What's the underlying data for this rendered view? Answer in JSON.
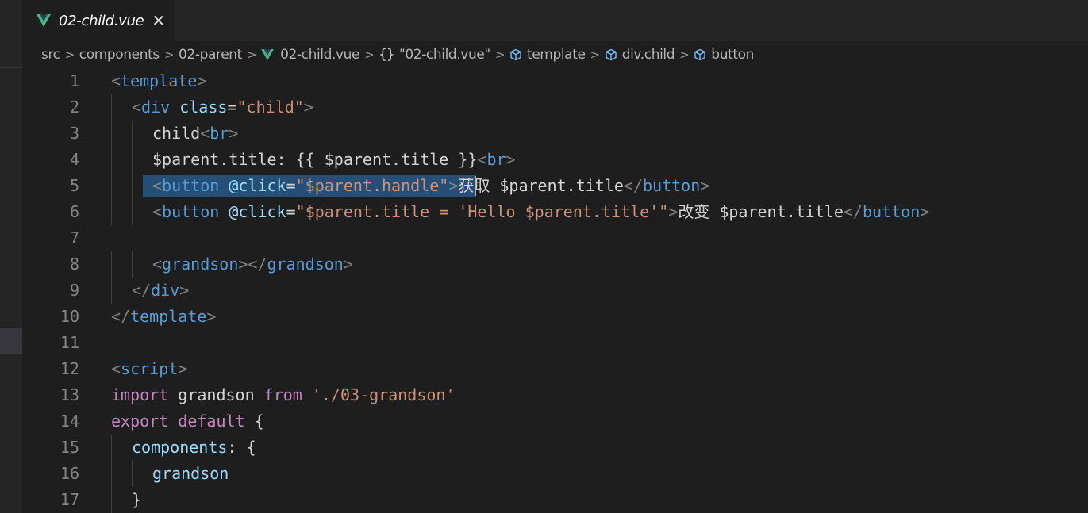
{
  "tab": {
    "title": "02-child.vue",
    "close_glyph": "✕",
    "icon": "vue-icon"
  },
  "breadcrumb": [
    {
      "label": "src"
    },
    {
      "label": "components"
    },
    {
      "label": "02-parent"
    },
    {
      "label": "02-child.vue",
      "icon": "vue-icon"
    },
    {
      "label": "\"02-child.vue\"",
      "icon": "braces-icon"
    },
    {
      "label": "template",
      "icon": "cube-icon"
    },
    {
      "label": "div.child",
      "icon": "cube-icon"
    },
    {
      "label": "button",
      "icon": "cube-icon"
    }
  ],
  "breadcrumb_sep": ">",
  "braces_glyph": "{}",
  "colors": {
    "tag": "#569cd6",
    "attr": "#9cdcfe",
    "string": "#ce9178",
    "keyword": "#c586c0",
    "text": "#d4d4d4",
    "selection": "#264f78",
    "vue_green": "#41b883"
  },
  "code_lines": [
    {
      "n": "1",
      "indent": 0,
      "tokens": [
        [
          "b",
          "<"
        ],
        [
          "tag",
          "template"
        ],
        [
          "b",
          ">"
        ]
      ]
    },
    {
      "n": "2",
      "indent": 1,
      "tokens": [
        [
          "b",
          "<"
        ],
        [
          "tag",
          "div"
        ],
        [
          "text",
          " "
        ],
        [
          "attr",
          "class"
        ],
        [
          "text",
          "="
        ],
        [
          "str",
          "\"child\""
        ],
        [
          "b",
          ">"
        ]
      ]
    },
    {
      "n": "3",
      "indent": 2,
      "tokens": [
        [
          "text",
          "child"
        ],
        [
          "b",
          "<"
        ],
        [
          "tag",
          "br"
        ],
        [
          "b",
          ">"
        ]
      ]
    },
    {
      "n": "4",
      "indent": 2,
      "tokens": [
        [
          "text",
          "$parent.title: {{ $parent.title }}"
        ],
        [
          "b",
          "<"
        ],
        [
          "tag",
          "br"
        ],
        [
          "b",
          ">"
        ]
      ]
    },
    {
      "n": "5",
      "indent": 2,
      "tokens": [
        [
          "b",
          "<"
        ],
        [
          "tag",
          "button"
        ],
        [
          "text",
          " "
        ],
        [
          "attr",
          "@click"
        ],
        [
          "text",
          "="
        ],
        [
          "str",
          "\"$parent.handle\""
        ],
        [
          "b",
          ">"
        ],
        [
          "text",
          "获取 $parent.title"
        ],
        [
          "b",
          "</"
        ],
        [
          "tag",
          "button"
        ],
        [
          "b",
          ">"
        ]
      ]
    },
    {
      "n": "6",
      "indent": 2,
      "tokens": [
        [
          "b",
          "<"
        ],
        [
          "tag",
          "button"
        ],
        [
          "text",
          " "
        ],
        [
          "attr",
          "@click"
        ],
        [
          "text",
          "="
        ],
        [
          "str",
          "\"$parent.title = "
        ],
        [
          "strq",
          "'Hello $parent.title'"
        ],
        [
          "str",
          "\""
        ],
        [
          "b",
          ">"
        ],
        [
          "text",
          "改变 $parent.title"
        ],
        [
          "b",
          "</"
        ],
        [
          "tag",
          "button"
        ],
        [
          "b",
          ">"
        ]
      ]
    },
    {
      "n": "7",
      "indent": 0,
      "tokens": []
    },
    {
      "n": "8",
      "indent": 2,
      "tokens": [
        [
          "b",
          "<"
        ],
        [
          "tag",
          "grandson"
        ],
        [
          "b",
          "></"
        ],
        [
          "tag",
          "grandson"
        ],
        [
          "b",
          ">"
        ]
      ]
    },
    {
      "n": "9",
      "indent": 1,
      "tokens": [
        [
          "b",
          "</"
        ],
        [
          "tag",
          "div"
        ],
        [
          "b",
          ">"
        ]
      ]
    },
    {
      "n": "10",
      "indent": 0,
      "tokens": [
        [
          "b",
          "</"
        ],
        [
          "tag",
          "template"
        ],
        [
          "b",
          ">"
        ]
      ]
    },
    {
      "n": "11",
      "indent": 0,
      "tokens": []
    },
    {
      "n": "12",
      "indent": 0,
      "tokens": [
        [
          "b",
          "<"
        ],
        [
          "tag",
          "script"
        ],
        [
          "b",
          ">"
        ]
      ]
    },
    {
      "n": "13",
      "indent": 0,
      "tokens": [
        [
          "kw",
          "import"
        ],
        [
          "text",
          " grandson "
        ],
        [
          "kw",
          "from"
        ],
        [
          "text",
          " "
        ],
        [
          "strq",
          "'./03-grandson'"
        ]
      ]
    },
    {
      "n": "14",
      "indent": 0,
      "tokens": [
        [
          "kw",
          "export"
        ],
        [
          "text",
          " "
        ],
        [
          "kw",
          "default"
        ],
        [
          "text",
          " {"
        ]
      ]
    },
    {
      "n": "15",
      "indent": 1,
      "tokens": [
        [
          "attr",
          "components"
        ],
        [
          "text",
          ": {"
        ]
      ]
    },
    {
      "n": "16",
      "indent": 2,
      "tokens": [
        [
          "attr",
          "grandson"
        ]
      ]
    },
    {
      "n": "17",
      "indent": 1,
      "tokens": [
        [
          "text",
          "}"
        ]
      ]
    }
  ]
}
